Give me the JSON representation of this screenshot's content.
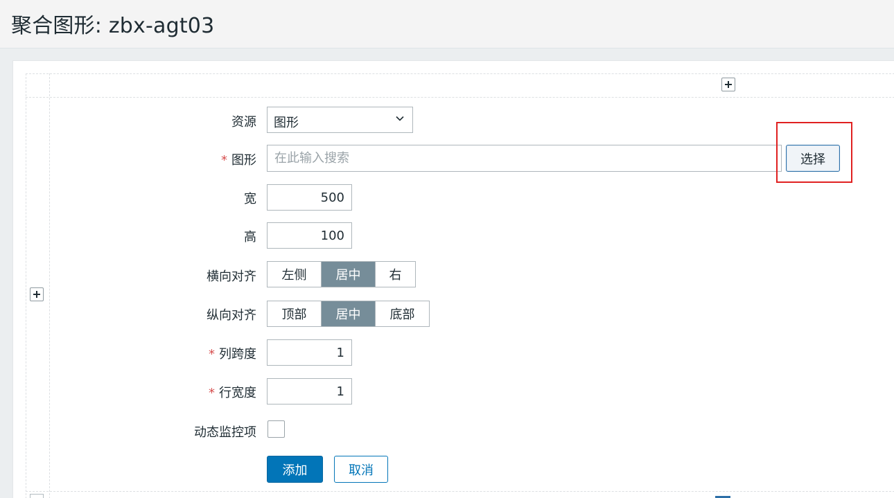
{
  "page": {
    "title": "聚合图形: zbx-agt03"
  },
  "form": {
    "source": {
      "label": "资源",
      "value": "图形"
    },
    "graph": {
      "required": "*",
      "label": "图形",
      "placeholder": "在此输入搜索",
      "select_label": "选择"
    },
    "width": {
      "label": "宽",
      "value": "500"
    },
    "height": {
      "label": "高",
      "value": "100"
    },
    "halign": {
      "label": "横向对齐",
      "options": [
        "左侧",
        "居中",
        "右"
      ],
      "selected": "居中"
    },
    "valign": {
      "label": "纵向对齐",
      "options": [
        "顶部",
        "居中",
        "底部"
      ],
      "selected": "居中"
    },
    "colspan": {
      "required": "*",
      "label": "列跨度",
      "value": "1"
    },
    "rowspan": {
      "required": "*",
      "label": "行宽度",
      "value": "1"
    },
    "dynamic": {
      "label": "动态监控项",
      "checked": false
    },
    "add_label": "添加",
    "cancel_label": "取消"
  },
  "icons": {
    "add_column": "plus-icon",
    "add_row": "plus-icon",
    "dropdown": "chevron-down-icon"
  },
  "colors": {
    "primary": "#0275b8",
    "segment_active": "#768d99",
    "required": "#d64e4e",
    "highlight": "#e02020"
  }
}
